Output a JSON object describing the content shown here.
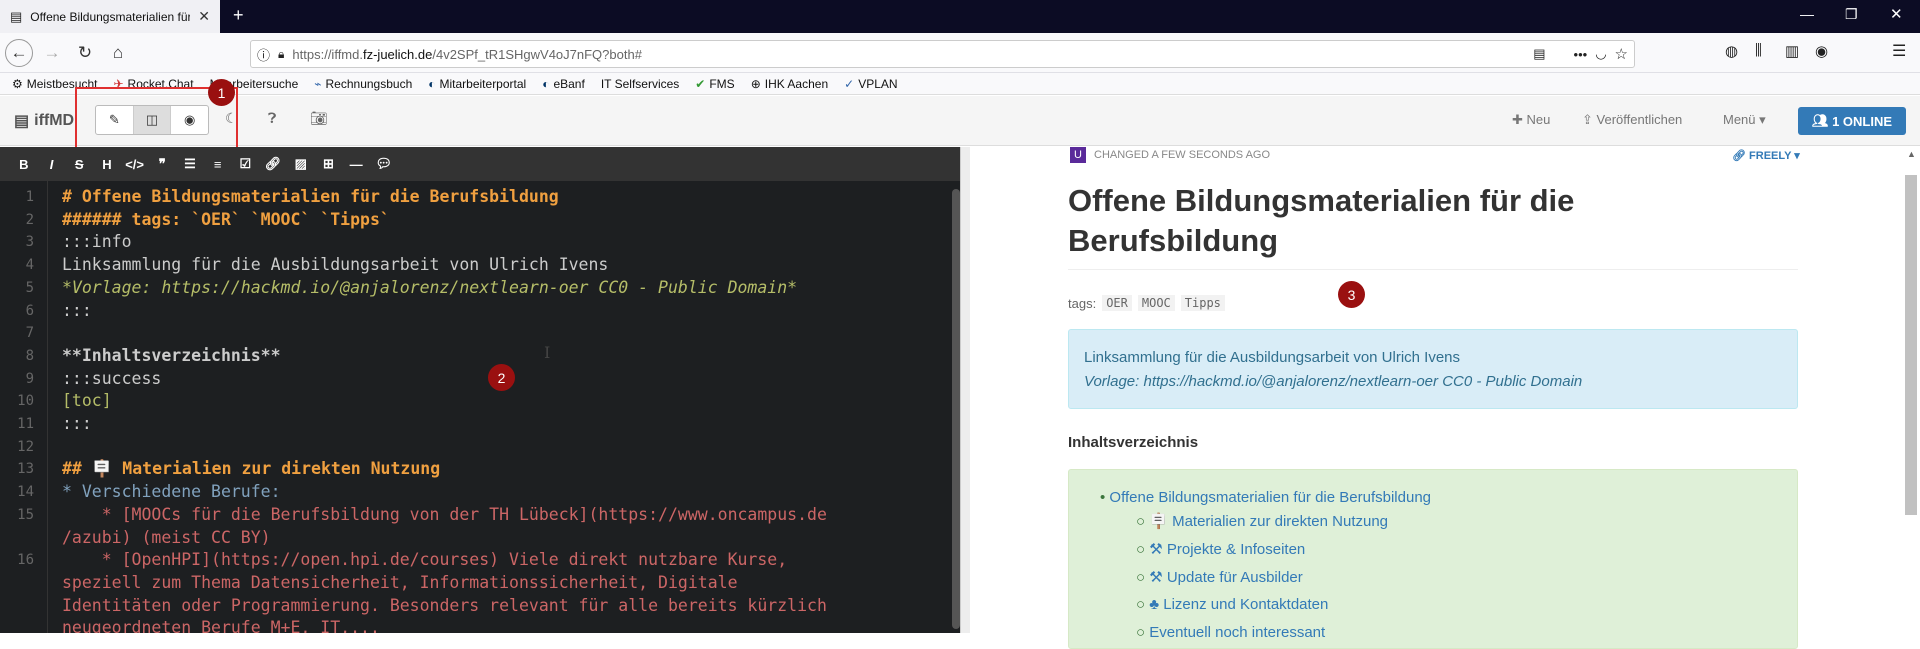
{
  "browser": {
    "tab_title": "Offene Bildungsmaterialien für",
    "url_prefix": "https://iffmd.",
    "url_domain": "fz-juelich.de",
    "url_path": "/4v2SPf_tR1SHgwV4oJ7nFQ?both#",
    "bookmarks": [
      "Meistbesucht",
      "Rocket.Chat",
      "Mitarbeitersuche",
      "Rechnungsbuch",
      "Mitarbeiterportal",
      "eBanf",
      "IT Selfservices",
      "FMS",
      "IHK Aachen",
      "VPLAN"
    ]
  },
  "app": {
    "brand": "iffMD",
    "new_label": "Neu",
    "publish_label": "Veröffentlichen",
    "menu_label": "Menü",
    "online_label": "1 ONLINE"
  },
  "markers": [
    "1",
    "2",
    "3"
  ],
  "editor": {
    "lines": [
      {
        "n": "1",
        "text": "# Offene Bildungsmaterialien für die Berufsbildung",
        "color": "#f0a040",
        "bold": true
      },
      {
        "n": "2",
        "text": "###### tags: `OER` `MOOC` `Tipps`",
        "color": "#f0a040",
        "bold": true
      },
      {
        "n": "3",
        "text": ":::info",
        "color": "#cccccc",
        "bold": false
      },
      {
        "n": "4",
        "text": "Linksammlung für die Ausbildungsarbeit von Ulrich Ivens",
        "color": "#cccccc",
        "bold": false
      },
      {
        "n": "5",
        "text": "*Vorlage: https://hackmd.io/@anjalorenz/nextlearn-oer CC0 - Public Domain*",
        "color": "#b5bd68",
        "bold": false,
        "italic": true
      },
      {
        "n": "6",
        "text": ":::",
        "color": "#cccccc",
        "bold": false
      },
      {
        "n": "7",
        "text": "",
        "color": "#cccccc",
        "bold": false
      },
      {
        "n": "8",
        "text": "**Inhaltsverzeichnis**",
        "color": "#cccccc",
        "bold": true
      },
      {
        "n": "9",
        "text": ":::success",
        "color": "#cccccc",
        "bold": false
      },
      {
        "n": "10",
        "text": "[toc]",
        "color": "#b5bd68",
        "bold": false
      },
      {
        "n": "11",
        "text": ":::",
        "color": "#cccccc",
        "bold": false
      },
      {
        "n": "12",
        "text": "",
        "color": "#cccccc",
        "bold": false
      },
      {
        "n": "13",
        "text": "## 🪧 Materialien zur direkten Nutzung",
        "color": "#f0a040",
        "bold": true
      },
      {
        "n": "14",
        "text": "* Verschiedene Berufe:",
        "color": "#81a2be",
        "bold": false
      },
      {
        "n": "15",
        "text": "    * [MOOCs für die Berufsbildung von der TH Lübeck](https://www.oncampus.de",
        "color": "#cc6666",
        "bold": false
      },
      {
        "n": "",
        "text": "/azubi) (meist CC BY)",
        "color": "#cc6666",
        "bold": false
      },
      {
        "n": "16",
        "text": "    * [OpenHPI](https://open.hpi.de/courses) Viele direkt nutzbare Kurse,",
        "color": "#cc6666",
        "bold": false
      },
      {
        "n": "",
        "text": "speziell zum Thema Datensicherheit, Informationssicherheit, Digitale",
        "color": "#cc6666",
        "bold": false
      },
      {
        "n": "",
        "text": "Identitäten oder Programmierung. Besonders relevant für alle bereits kürzlich",
        "color": "#cc6666",
        "bold": false
      },
      {
        "n": "",
        "text": "neugeordneten Berufe M+E, IT,...",
        "color": "#cc6666",
        "bold": false
      }
    ]
  },
  "preview": {
    "changed_label": "CHANGED A FEW SECONDS AGO",
    "user_initial": "U",
    "visibility": "FREELY",
    "title_line1": "Offene Bildungsmaterialien für die",
    "title_line2": "Berufsbildung",
    "tags_label": "tags:",
    "tags": [
      "OER",
      "MOOC",
      "Tipps"
    ],
    "info_line1": "Linksammlung für die Ausbildungsarbeit von Ulrich Ivens",
    "info_line2": "Vorlage: https://hackmd.io/@anjalorenz/nextlearn-oer CC0 - Public Domain",
    "toc_heading": "Inhaltsverzeichnis",
    "toc_main": "Offene Bildungsmaterialien für die Berufsbildung",
    "toc_items": [
      "🪧 Materialien zur direkten Nutzung",
      "⚒ Projekte & Infoseiten",
      "⚒ Update für Ausbilder",
      "♣ Lizenz und Kontaktdaten",
      "Eventuell noch interessant"
    ]
  }
}
